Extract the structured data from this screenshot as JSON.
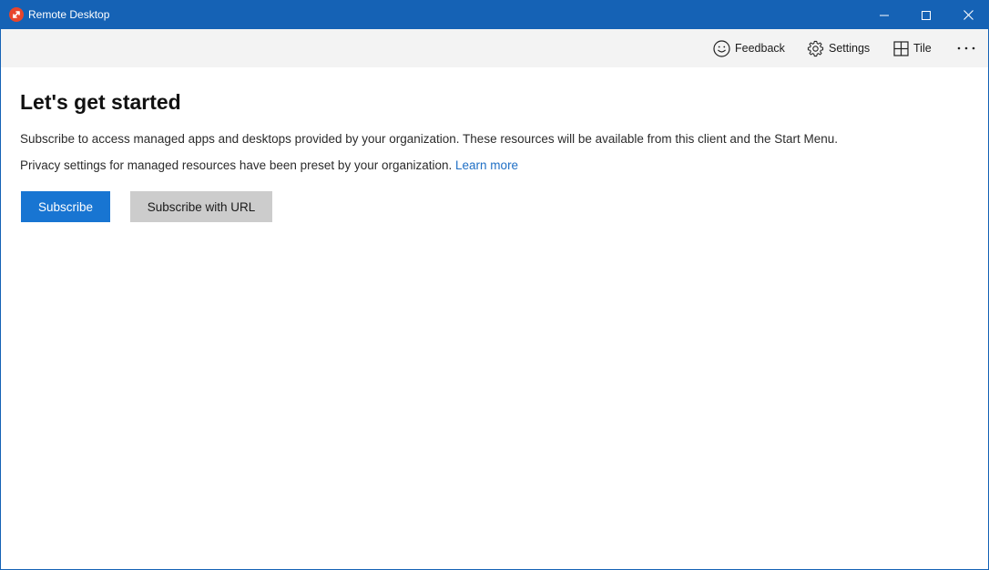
{
  "window": {
    "title": "Remote Desktop"
  },
  "toolbar": {
    "feedback_label": "Feedback",
    "settings_label": "Settings",
    "tile_label": "Tile"
  },
  "main": {
    "heading": "Let's get started",
    "description_1": "Subscribe to access managed apps and desktops provided by your organization. These resources will be available from this client and the Start Menu.",
    "description_2": "Privacy settings for managed resources have been preset by your organization.",
    "learn_more": "Learn more",
    "subscribe_label": "Subscribe",
    "subscribe_url_label": "Subscribe with URL"
  },
  "colors": {
    "titlebar": "#1562b5",
    "primary_button": "#1875d2",
    "secondary_button": "#cccccc",
    "link": "#1f6fc5",
    "app_icon": "#e8452c"
  },
  "icons": {
    "app": "remote-desktop-icon",
    "minimize": "minimize-icon",
    "maximize": "maximize-icon",
    "close": "close-icon",
    "feedback": "smiley-icon",
    "settings": "gear-icon",
    "tile": "grid-icon",
    "more": "more-horizontal-icon"
  }
}
